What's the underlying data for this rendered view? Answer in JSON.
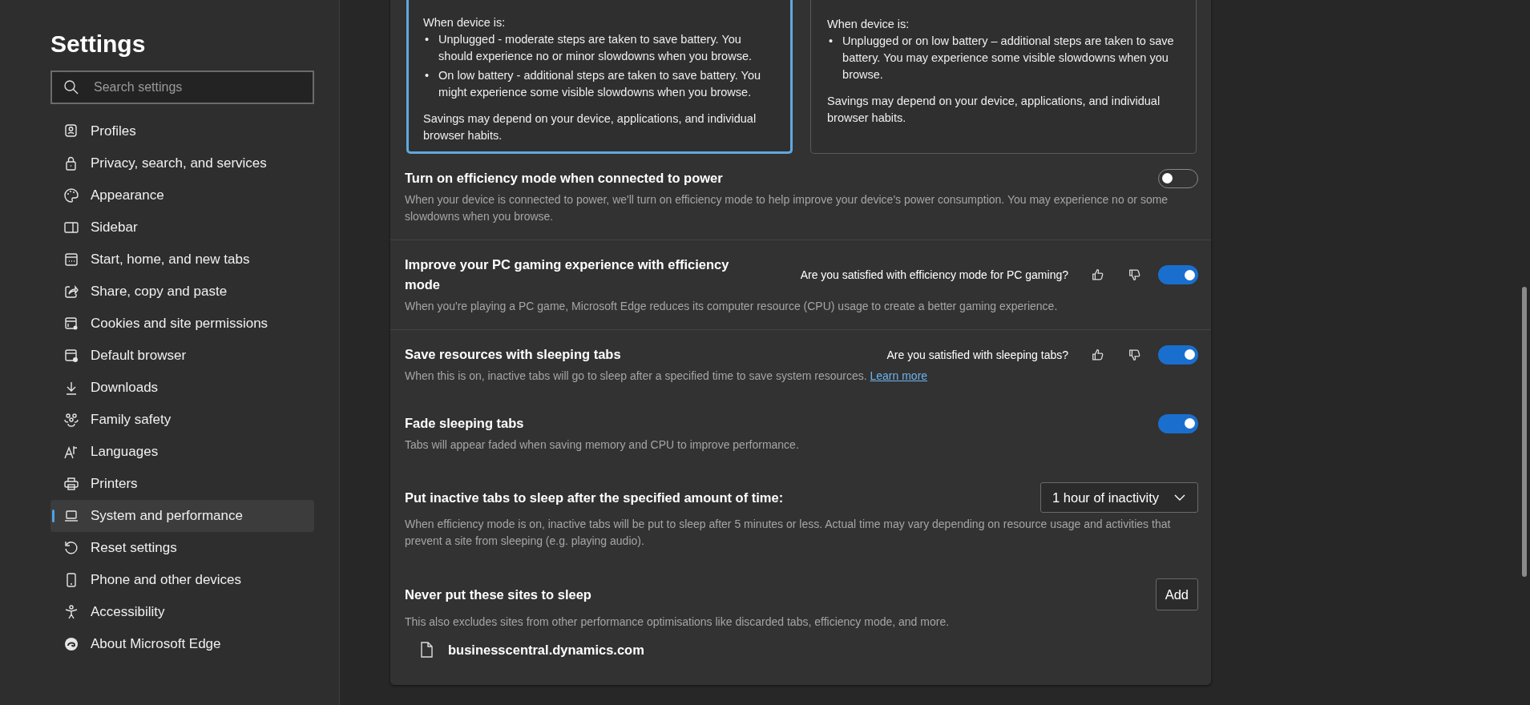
{
  "sidebar": {
    "title": "Settings",
    "search": {
      "placeholder": "Search settings"
    },
    "items": [
      {
        "label": "Profiles",
        "selected": false
      },
      {
        "label": "Privacy, search, and services",
        "selected": false
      },
      {
        "label": "Appearance",
        "selected": false
      },
      {
        "label": "Sidebar",
        "selected": false
      },
      {
        "label": "Start, home, and new tabs",
        "selected": false
      },
      {
        "label": "Share, copy and paste",
        "selected": false
      },
      {
        "label": "Cookies and site permissions",
        "selected": false
      },
      {
        "label": "Default browser",
        "selected": false
      },
      {
        "label": "Downloads",
        "selected": false
      },
      {
        "label": "Family safety",
        "selected": false
      },
      {
        "label": "Languages",
        "selected": false
      },
      {
        "label": "Printers",
        "selected": false
      },
      {
        "label": "System and performance",
        "selected": true
      },
      {
        "label": "Reset settings",
        "selected": false
      },
      {
        "label": "Phone and other devices",
        "selected": false
      },
      {
        "label": "Accessibility",
        "selected": false
      },
      {
        "label": "About Microsoft Edge",
        "selected": false
      }
    ]
  },
  "option_cards": [
    {
      "selected": true,
      "intro": "When device is:",
      "bullets": [
        {
          "marker": "•",
          "text": "Unplugged - moderate steps are taken to save battery. You should experience no or minor slowdowns when you browse."
        },
        {
          "marker": "•",
          "text": "On low battery - additional steps are taken to save battery. You might experience some visible slowdowns when you browse."
        }
      ],
      "note": "Savings may depend on your device, applications, and individual browser habits."
    },
    {
      "selected": false,
      "intro": "When device is:",
      "bullets": [
        {
          "marker": "•",
          "text": "Unplugged or on low battery – additional steps are taken to save battery. You may experience some visible slowdowns when you browse."
        }
      ],
      "note": "Savings may depend on your device, applications, and individual browser habits."
    }
  ],
  "settings": [
    {
      "kind": "toggle",
      "title": "Turn on efficiency mode when connected to power",
      "description": "When your device is connected to power, we'll turn on efficiency mode to help improve your device's power consumption. You may experience no or some slowdowns when you browse.",
      "on": false,
      "divider": true
    },
    {
      "kind": "toggle",
      "title": "Improve your PC gaming experience with efficiency mode",
      "feedback": "Are you satisfied with efficiency mode for PC gaming?",
      "description": "When you're playing a PC game, Microsoft Edge reduces its computer resource (CPU) usage to create a better gaming experience.",
      "on": true,
      "divider": true
    },
    {
      "kind": "toggle",
      "title": "Save resources with sleeping tabs",
      "feedback": "Are you satisfied with sleeping tabs?",
      "description": "When this is on, inactive tabs will go to sleep after a specified time to save system resources.",
      "link": "Learn more",
      "on": true,
      "divider": false
    },
    {
      "kind": "toggle",
      "title": "Fade sleeping tabs",
      "description": "Tabs will appear faded when saving memory and CPU to improve performance.",
      "on": true,
      "divider": false
    },
    {
      "kind": "dropdown",
      "title": "Put inactive tabs to sleep after the specified amount of time:",
      "description": "When efficiency mode is on, inactive tabs will be put to sleep after 5 minutes or less. Actual time may vary depending on resource usage and activities that prevent a site from sleeping (e.g. playing audio).",
      "value": "1 hour of inactivity",
      "divider": false
    },
    {
      "kind": "sites",
      "title": "Never put these sites to sleep",
      "description": "This also excludes sites from other performance optimisations like discarded tabs, efficiency mode, and more.",
      "button": "Add",
      "sites": [
        "businesscentral.dynamics.com"
      ],
      "divider": false
    }
  ]
}
